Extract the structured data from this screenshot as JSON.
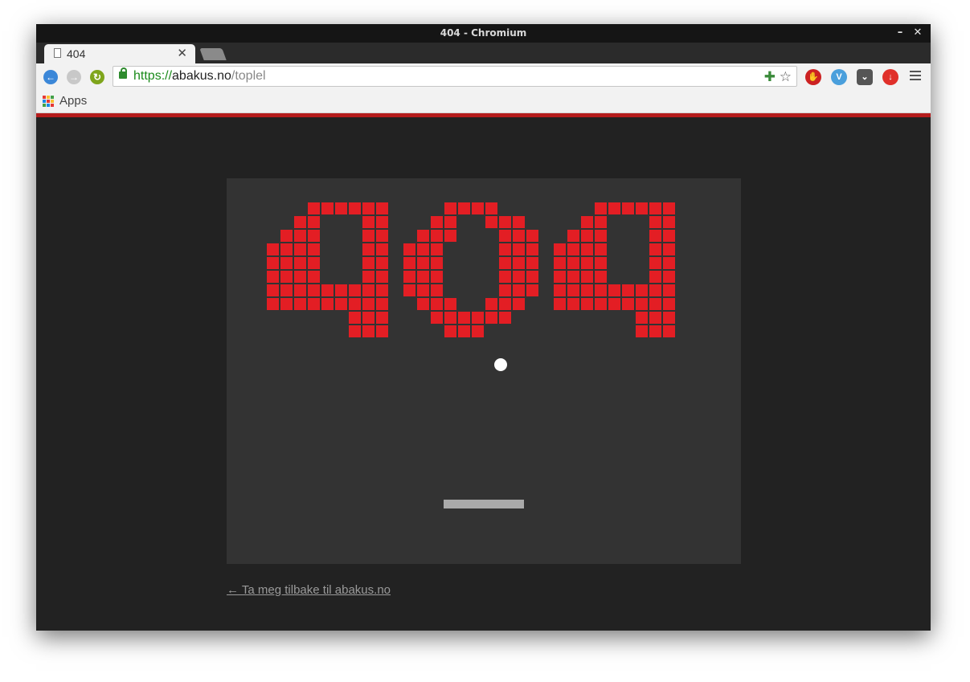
{
  "window": {
    "title": "404 - Chromium",
    "minimize_glyph": "–",
    "close_glyph": "✕"
  },
  "tab": {
    "label": "404",
    "close_glyph": "✕",
    "icon": "page-icon"
  },
  "omnibox": {
    "scheme": "https://",
    "host": "abakus.no",
    "path": "/toplel"
  },
  "bookmarks": {
    "apps_label": "Apps"
  },
  "colors": {
    "accent_bar": "#b51c1c",
    "brick": "#e31e24",
    "page_bg": "#222222",
    "game_bg": "#333333",
    "paddle": "#aaaaaa",
    "ball": "#ffffff"
  },
  "game": {
    "message": "404",
    "glyphs": {
      "4": [
        "...######",
        "..##...##",
        ".###...##",
        "####...##",
        "####...##",
        "####...##",
        "#########",
        "#########",
        "......###",
        "......###"
      ],
      "0": [
        "...####...",
        "..##..###.",
        ".###...###",
        "###....###",
        "###....###",
        "###....###",
        "###....###",
        ".###..###.",
        "..######..",
        "...###...."
      ]
    }
  },
  "footer": {
    "back_link": "← Ta meg tilbake til abakus.no"
  }
}
